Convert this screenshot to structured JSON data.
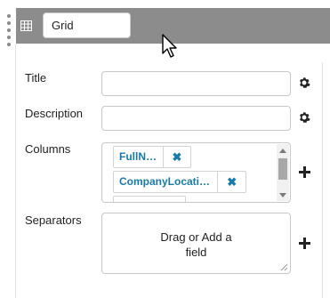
{
  "header": {
    "name_value": "Grid",
    "icon": "grid-icon"
  },
  "form": {
    "title_label": "Title",
    "title_value": "",
    "description_label": "Description",
    "description_value": "",
    "columns_label": "Columns",
    "columns": [
      {
        "label": "FullName",
        "remove_icon": "✖"
      },
      {
        "label": "CompanyLocation...",
        "remove_icon": "✖"
      }
    ],
    "separators_label": "Separators",
    "separators_drop_line1": "Drag or Add a",
    "separators_drop_line2": "field"
  },
  "colors": {
    "header_bg": "#8c8c8c",
    "chip_text": "#1a7aa6"
  }
}
